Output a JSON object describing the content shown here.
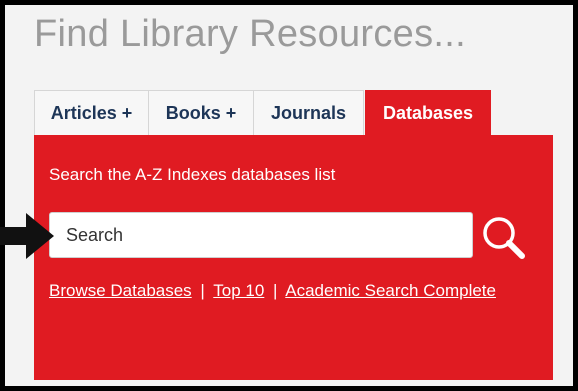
{
  "widget": {
    "title": "Find Library Resources..."
  },
  "tabs": [
    {
      "label": "Articles +",
      "active": false
    },
    {
      "label": "Books +",
      "active": false
    },
    {
      "label": "Journals",
      "active": false
    },
    {
      "label": "Databases",
      "active": true
    }
  ],
  "panel": {
    "description": "Search the A-Z Indexes databases list",
    "search_placeholder": "Search",
    "search_icon": "magnifier-icon",
    "links": {
      "browse": "Browse Databases",
      "sep1": "|",
      "top10": "Top 10",
      "sep2": "|",
      "academic": "Academic Search Complete"
    }
  },
  "colors": {
    "accent": "#e01b22",
    "tab_text": "#1d3557",
    "title": "#9a9a9a"
  },
  "annotation": {
    "pointer_icon": "arrow-pointer-icon"
  }
}
